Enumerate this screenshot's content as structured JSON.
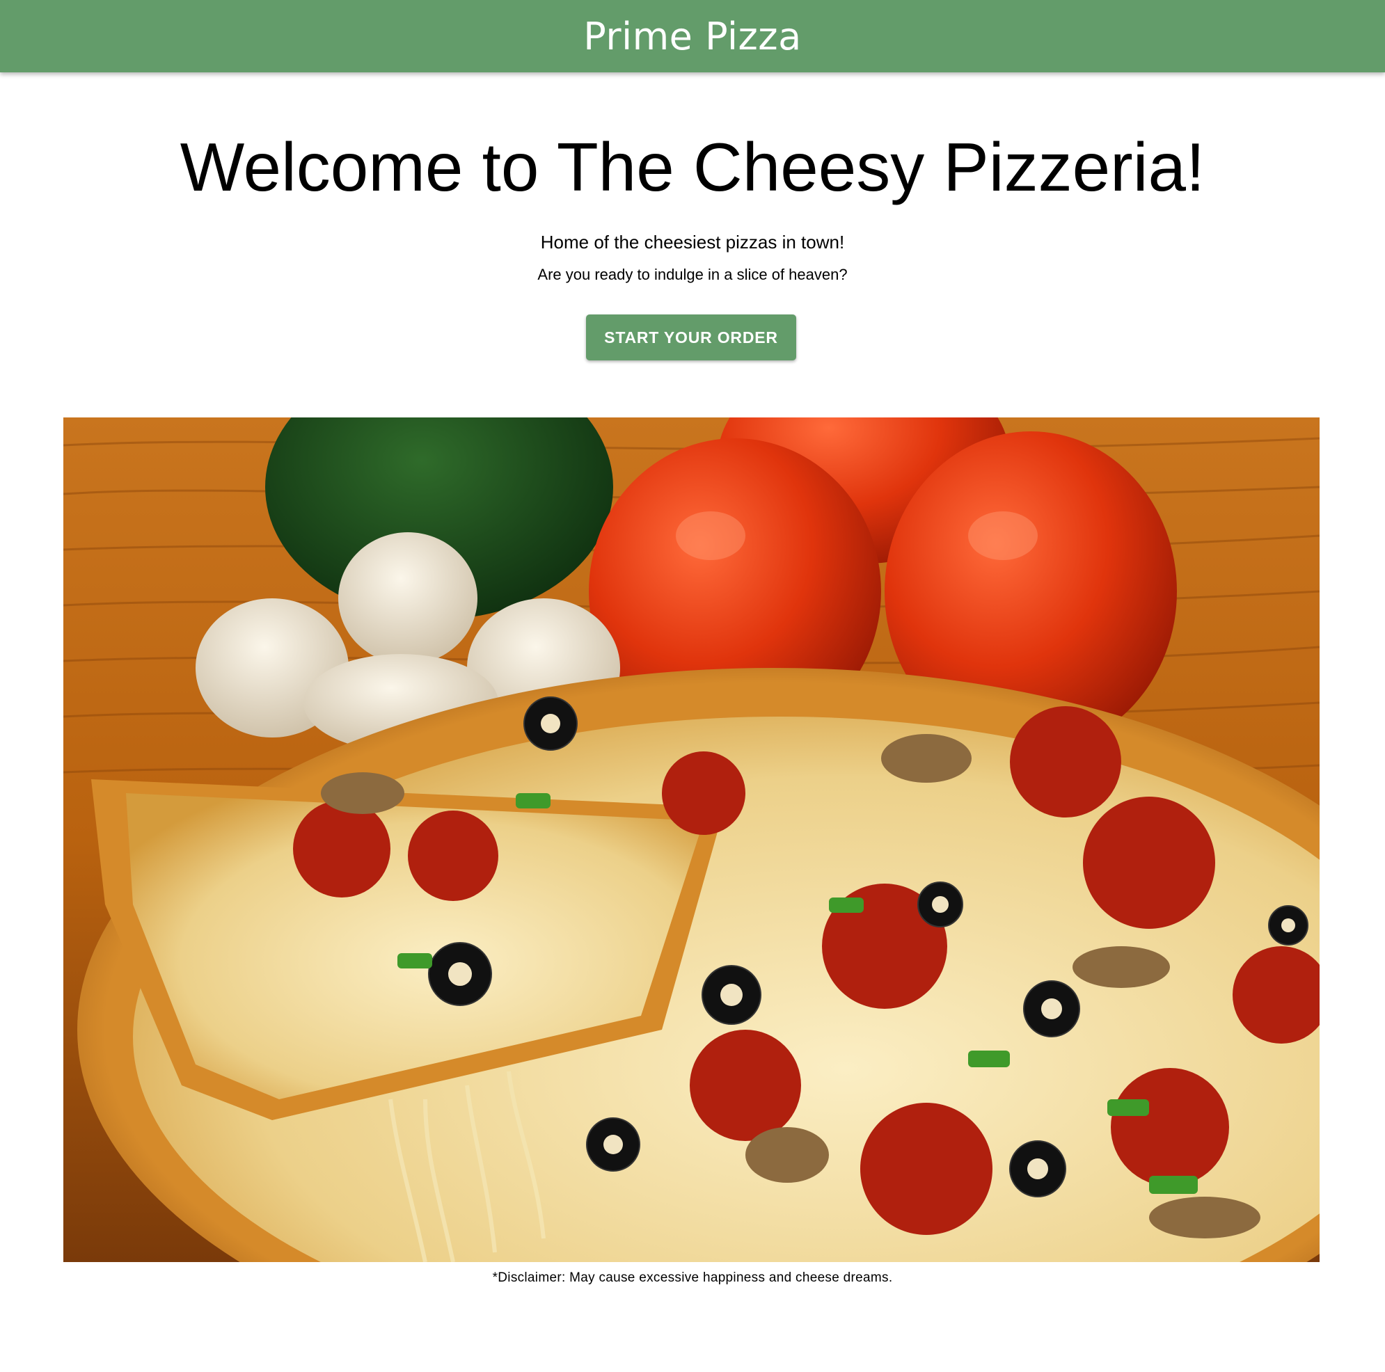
{
  "app_bar": {
    "title": "Prime Pizza",
    "color": "#639c6a"
  },
  "hero": {
    "title": "Welcome to The Cheesy Pizzeria!",
    "tagline": "Home of the cheesiest pizzas in town!",
    "subtagline": "Are you ready to indulge in a slice of heaven?",
    "cta_label": "START YOUR ORDER"
  },
  "image": {
    "subject": "pizza-photo"
  },
  "footer": {
    "disclaimer": "*Disclaimer: May cause excessive happiness and cheese dreams."
  }
}
